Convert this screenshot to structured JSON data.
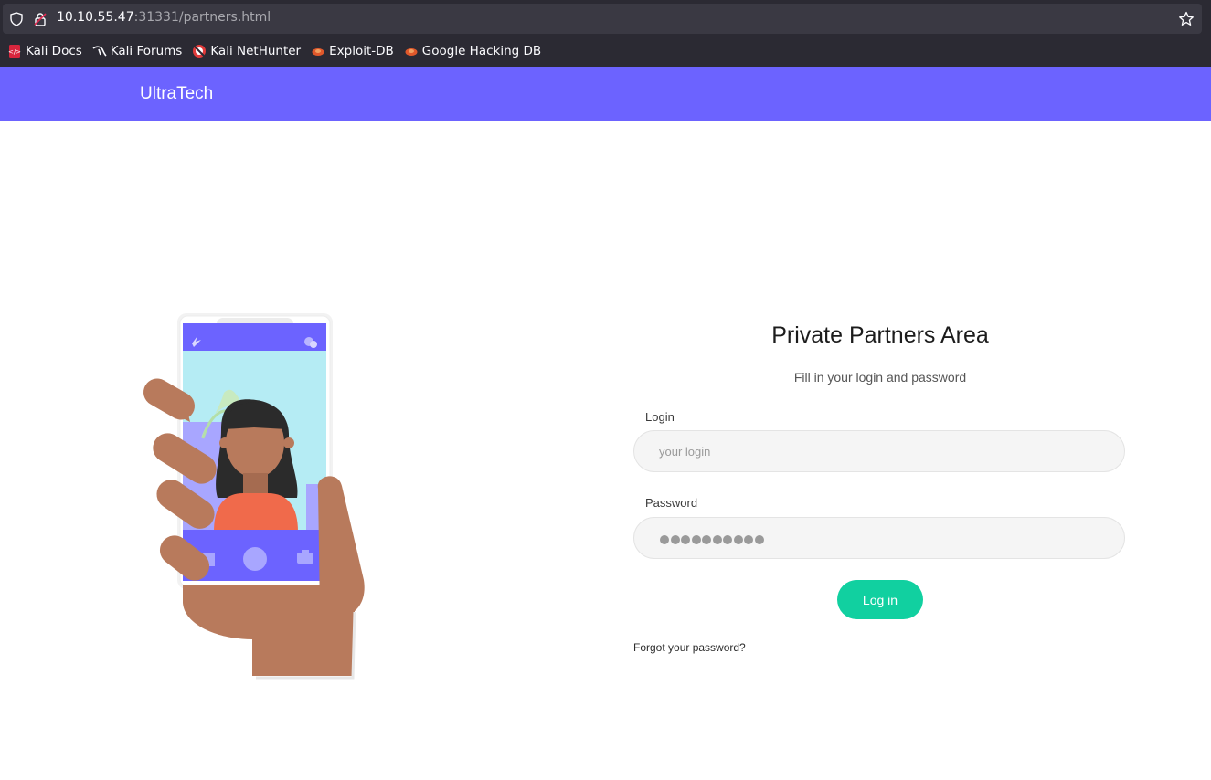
{
  "browser": {
    "url_host": "10.10.55.47",
    "url_rest": ":31331/partners.html",
    "bookmarks": [
      {
        "label": "Kali Docs",
        "icon": "kali-docs-icon"
      },
      {
        "label": "Kali Forums",
        "icon": "kali-dragon-icon"
      },
      {
        "label": "Kali NetHunter",
        "icon": "nethunter-icon"
      },
      {
        "label": "Exploit-DB",
        "icon": "exploit-db-icon"
      },
      {
        "label": "Google Hacking DB",
        "icon": "ghdb-icon"
      }
    ]
  },
  "site": {
    "brand": "UltraTech",
    "nav_color": "#6c63ff"
  },
  "login": {
    "title": "Private Partners Area",
    "subtitle": "Fill in your login and password",
    "login_label": "Login",
    "login_placeholder": "your login",
    "password_label": "Password",
    "button_label": "Log in",
    "button_color": "#11d0a0",
    "forgot_label": "Forgot your password?"
  }
}
